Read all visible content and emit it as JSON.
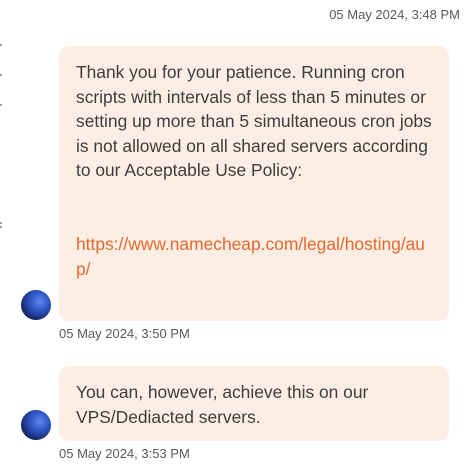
{
  "messages": [
    {
      "timestamp": "05 May 2024, 3:48 PM"
    },
    {
      "text": "Thank you for your patience. Running cron scripts with intervals of less than 5 minutes or setting up more than 5 simultaneous cron jobs is not allowed on all shared servers according to our Acceptable Use Policy:",
      "link": "https://www.namecheap.com/legal/hosting/aup/",
      "timestamp": "05 May 2024, 3:50 PM"
    },
    {
      "text": "You can, however, achieve this on our VPS/Dediacted servers.",
      "timestamp": "05 May 2024, 3:53 PM"
    }
  ],
  "colors": {
    "bubble_bg": "#fdeee5",
    "link": "#e4692c",
    "timestamp": "#555a60"
  }
}
